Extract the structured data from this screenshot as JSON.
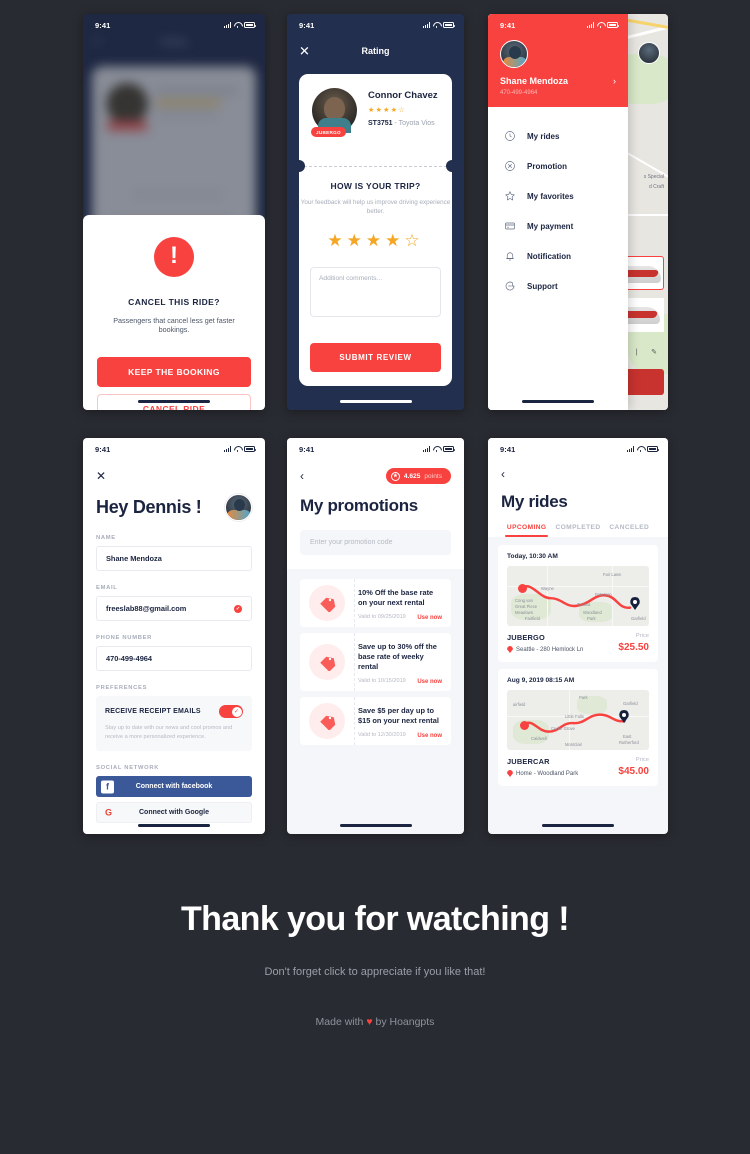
{
  "status_bar": {
    "time": "9:41"
  },
  "phone1_cancel_modal": {
    "blurred_title": "Rating",
    "alert_icon": "exclamation-icon",
    "title": "CANCEL THIS RIDE?",
    "subtitle": "Passengers that cancel less get faster bookings.",
    "primary_button": "KEEP THE BOOKING",
    "secondary_button": "CANCEL RIDE"
  },
  "phone2_rating": {
    "nav_title": "Rating",
    "close_icon": "close-icon",
    "driver": {
      "name": "Connor Chavez",
      "badge": "JUBERGO",
      "stars_filled": 4,
      "stars_total": 5,
      "plate": "ST3751",
      "car": " - Toyota Vios"
    },
    "question": "HOW IS YOUR TRIP?",
    "question_sub": "Your feedback will help us improve driving experience better.",
    "rating_value": 4,
    "comment_placeholder": "Additionl comments...",
    "submit_label": "SUBMIT REVIEW"
  },
  "phone3_drawer": {
    "user_name": "Shane Mendoza",
    "user_phone": "470-499-4964",
    "chevron": "›",
    "menu": [
      {
        "label": "My rides",
        "icon": "clock-icon"
      },
      {
        "label": "Promotion",
        "icon": "tag-circle-icon"
      },
      {
        "label": "My favorites",
        "icon": "star-icon"
      },
      {
        "label": "My payment",
        "icon": "credit-card-icon"
      },
      {
        "label": "Notification",
        "icon": "bell-icon"
      },
      {
        "label": "Support",
        "icon": "chat-icon"
      }
    ]
  },
  "phone4_profile": {
    "close_icon": "close-icon",
    "greeting": "Hey Dennis !",
    "avatar": "user-avatar",
    "fields": [
      {
        "label": "NAME",
        "value": "Shane Mendoza",
        "verified": false
      },
      {
        "label": "EMAIL",
        "value": "freeslab88@gmail.com",
        "verified": true
      },
      {
        "label": "PHONE NUMBER",
        "value": "470-499-4964",
        "verified": false
      }
    ],
    "preferences_label": "PREFERENCES",
    "preference": {
      "title": "RECEIVE RECEIPT EMAILS",
      "description": "Stay up to date with our news and cool promos and receive a more personalized experience.",
      "enabled": true
    },
    "social_label": "SOCIAL NETWORK",
    "social": [
      {
        "label": "Connect with facebook",
        "provider": "facebook"
      },
      {
        "label": "Connect with Google",
        "provider": "google"
      }
    ]
  },
  "phone5_promotions": {
    "back_icon": "chevron-left-icon",
    "points_value": "4.625",
    "points_unit": "points",
    "title": "My promotions",
    "input_placeholder": "Enter your promotion code",
    "items": [
      {
        "text": "10% Off the base rate on your next rental",
        "valid": "Valid to 09/25/2019",
        "action": "Use now"
      },
      {
        "text": "Save up to 30% off the base rate of weeky rental",
        "valid": "Valid to 10/15/2019",
        "action": "Use now"
      },
      {
        "text": "Save $5 per day up to $15 on your next rental",
        "valid": "Valid to 12/30/2019",
        "action": "Use now"
      }
    ]
  },
  "phone6_rides": {
    "back_icon": "chevron-left-icon",
    "title": "My rides",
    "tabs": [
      {
        "label": "UPCOMING",
        "active": true
      },
      {
        "label": "COMPLETED",
        "active": false
      },
      {
        "label": "CANCELED",
        "active": false
      }
    ],
    "rides": [
      {
        "date": "Today, 10:30 AM",
        "company": "JUBERGO",
        "location": "Seattle - 280 Hemlock Ln",
        "price_label": "Price",
        "price": "$25.50",
        "map_labels": [
          "Fair Lawn",
          "Paterson",
          "Wayne",
          "Totowa",
          "Woodland Park",
          "Fairfield",
          "Garfield",
          "Cong van Great Piece Meadows"
        ]
      },
      {
        "date": "Aug 9, 2019 08:15 AM",
        "company": "JUBERCAR",
        "location": "Home - Woodland Park",
        "price_label": "Price",
        "price": "$45.00",
        "map_labels": [
          "Park",
          "Garfield",
          "Little Falls",
          "Cedar Grove",
          "Caldwell",
          "Montclair",
          "East Rutherford",
          "airfield"
        ]
      }
    ]
  },
  "footer": {
    "heading": "Thank you for watching !",
    "subheading": "Don't forget click to appreciate if you like that!",
    "made_prefix": "Made with ",
    "made_heart": "♥",
    "made_suffix": " by Hoangpts"
  },
  "colors": {
    "background": "#292B32",
    "primary_red": "#F8423F",
    "navy": "#232F4E",
    "star_gold": "#F5A623",
    "facebook_blue": "#3B5998"
  }
}
